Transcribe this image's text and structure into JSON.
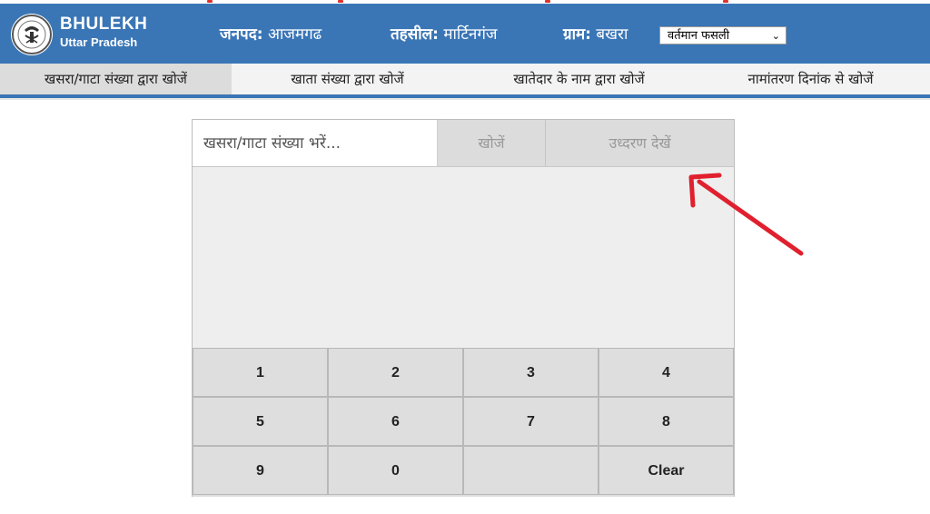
{
  "brand": {
    "title": "BHULEKH",
    "subtitle": "Uttar Pradesh"
  },
  "header": {
    "district_label": "जनपद:",
    "district_value": "आजमगढ",
    "tehsil_label": "तहसील:",
    "tehsil_value": "मार्टिनगंज",
    "village_label": "ग्राम:",
    "village_value": "बखरा",
    "fasli_selected": "वर्तमान फसली"
  },
  "tabs": [
    {
      "label": "खसरा/गाटा संख्या द्वारा खोजें",
      "active": true
    },
    {
      "label": "खाता संख्या द्वारा खोजें"
    },
    {
      "label": "खातेदार के नाम द्वारा खोजें"
    },
    {
      "label": "नामांतरण दिनांक से खोजें"
    }
  ],
  "search": {
    "placeholder": "खसरा/गाटा संख्या भरें...",
    "search_label": "खोजें",
    "view_extract_label": "उध्दरण देखें"
  },
  "keypad": {
    "keys": [
      "1",
      "2",
      "3",
      "4",
      "5",
      "6",
      "7",
      "8",
      "9",
      "0",
      "",
      "Clear"
    ]
  },
  "colors": {
    "header": "#3a76b6",
    "arrow": "#e0202e"
  }
}
